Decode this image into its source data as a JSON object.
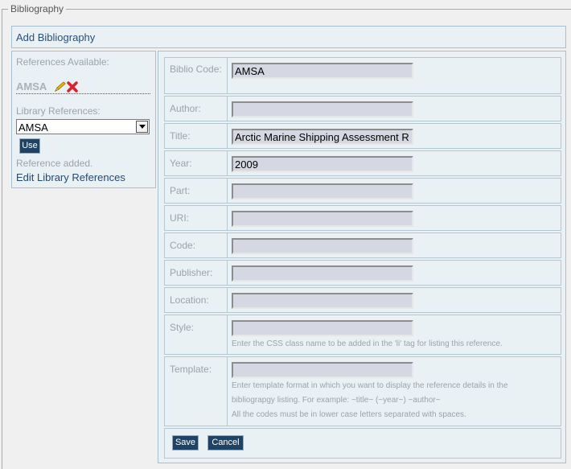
{
  "section": {
    "legend": "Bibliography",
    "add_title": "Add Bibliography"
  },
  "left": {
    "available_label": "References Available:",
    "available_item": "AMSA",
    "library_label": "Library References:",
    "library_selected": "AMSA",
    "use_label": "Use",
    "status": "Reference added.",
    "edit_link": "Edit Library References"
  },
  "form": {
    "biblio_code": {
      "label": "Biblio Code:",
      "value": "AMSA"
    },
    "author": {
      "label": "Author:",
      "value": ""
    },
    "title": {
      "label": "Title:",
      "value": "Arctic Marine Shipping Assessment R"
    },
    "year": {
      "label": "Year:",
      "value": "2009"
    },
    "part": {
      "label": "Part:",
      "value": ""
    },
    "uri": {
      "label": "URI:",
      "value": ""
    },
    "code": {
      "label": "Code:",
      "value": ""
    },
    "publisher": {
      "label": "Publisher:",
      "value": ""
    },
    "location": {
      "label": "Location:",
      "value": ""
    },
    "style": {
      "label": "Style:",
      "value": "",
      "hint": "Enter the CSS class name to be added in the 'li' tag for listing this reference."
    },
    "template": {
      "label": "Template:",
      "value": "",
      "hint1": "Enter template format in which you want to display the reference details in the",
      "hint2": "bibliograpgy listing. For example: ~title~ (~year~) ~author~",
      "hint3": "All the codes must be in lower case letters separated with spaces."
    },
    "save_label": "Save",
    "cancel_label": "Cancel"
  },
  "colors": {
    "panel_bg": "#e9f1f5",
    "button_bg": "#1d4466",
    "link": "#244a72"
  }
}
